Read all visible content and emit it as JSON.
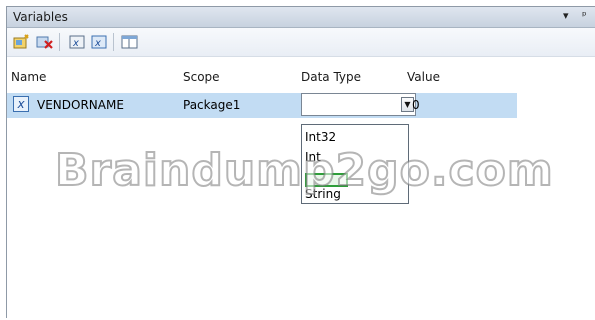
{
  "window": {
    "title": "Variables",
    "pin_glyph": "▾ ᵖ"
  },
  "toolbar": {
    "buttons": [
      {
        "name": "add-variable-button",
        "icon": "add-variable-icon"
      },
      {
        "name": "delete-variable-button",
        "icon": "delete-variable-icon"
      },
      {
        "name": "show-system-variables-button",
        "icon": "system-variables-icon"
      },
      {
        "name": "show-all-variables-button",
        "icon": "all-variables-icon"
      },
      {
        "name": "choose-columns-button",
        "icon": "columns-icon"
      }
    ]
  },
  "grid": {
    "columns": [
      "Name",
      "Scope",
      "Data Type",
      "Value"
    ],
    "row": {
      "icon_glyph": "x",
      "name": "VENDORNAME",
      "scope": "Package1",
      "data_type": "",
      "value": "0"
    }
  },
  "dropdown": {
    "options": [
      "Int32",
      "Int",
      "",
      "String"
    ]
  },
  "watermark": "Braindump2go.com"
}
